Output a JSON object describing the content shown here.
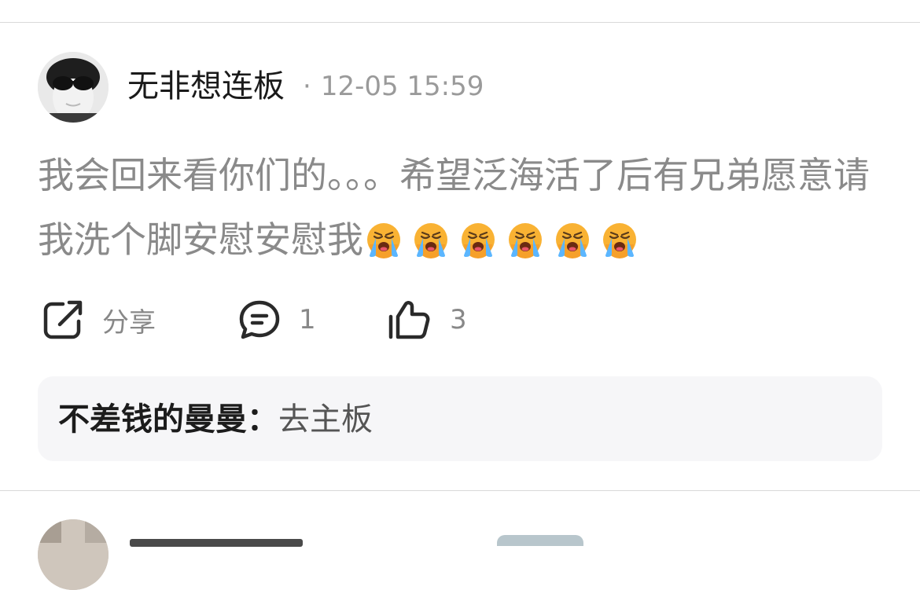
{
  "post": {
    "username": "无非想连板",
    "meta_separator": "·",
    "timestamp": "12-05 15:59",
    "content_text": "我会回来看你们的。。。希望泛海活了后有兄弟愿意请我洗个脚安慰安慰我",
    "emojis": [
      "loudly-crying-face-icon",
      "loudly-crying-face-icon",
      "loudly-crying-face-icon",
      "loudly-crying-face-icon",
      "loudly-crying-face-icon",
      "loudly-crying-face-icon"
    ]
  },
  "actions": {
    "share_label": "分享",
    "comment_count": "1",
    "like_count": "3"
  },
  "reply": {
    "author": "不差钱的曼曼：",
    "content": "去主板"
  },
  "colors": {
    "divider": "#d9d9d9",
    "reply_bg": "#f6f6f8",
    "body_text": "#8a8a8a",
    "meta_text": "#9a9a9a"
  }
}
